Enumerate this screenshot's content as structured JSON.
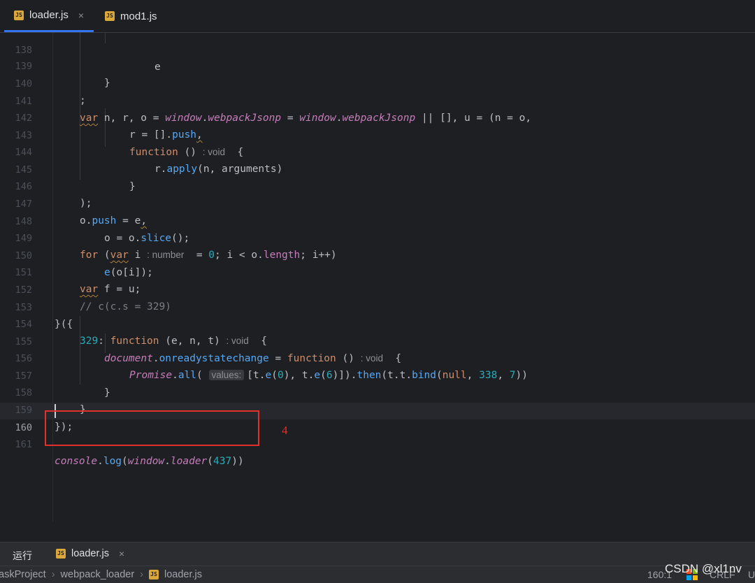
{
  "tabs": [
    {
      "label": "loader.js",
      "icon": "js-file-icon",
      "active": true,
      "close": "×"
    },
    {
      "label": "mod1.js",
      "icon": "js-file-icon",
      "active": false
    }
  ],
  "js_badge": "JS",
  "editor": {
    "lines": {
      "138": "138",
      "139": "139",
      "140": "140",
      "141": "141",
      "142": "142",
      "143": "143",
      "144": "144",
      "145": "145",
      "146": "146",
      "147": "147",
      "148": "148",
      "149": "149",
      "150": "150",
      "151": "151",
      "152": "152",
      "153": "153",
      "154": "154",
      "155": "155",
      "156": "156",
      "157": "157",
      "158": "158",
      "159": "159",
      "160": "160",
      "161": "161"
    },
    "hints": {
      "void": ": void",
      "number": ": number",
      "values": "values:"
    },
    "comment_152": "// c(c.s = 329)",
    "num_329": "329",
    "num_0": "0",
    "num_6": "6",
    "num_338": "338",
    "num_7": "7",
    "num_437": "437"
  },
  "annotation": "4",
  "run_panel": {
    "label": "运行",
    "tab_label": "loader.js",
    "close": "×"
  },
  "status_bar": {
    "breadcrumbs": [
      "askProject",
      "webpack_loader",
      "loader.js"
    ],
    "position": "160:1",
    "line_ending": "CRLF",
    "extra": "U"
  },
  "watermark": "CSDN @xl1nv",
  "colors": {
    "background": "#1e1f22",
    "accent": "#3574f0",
    "annotation_red": "#e0312b"
  }
}
